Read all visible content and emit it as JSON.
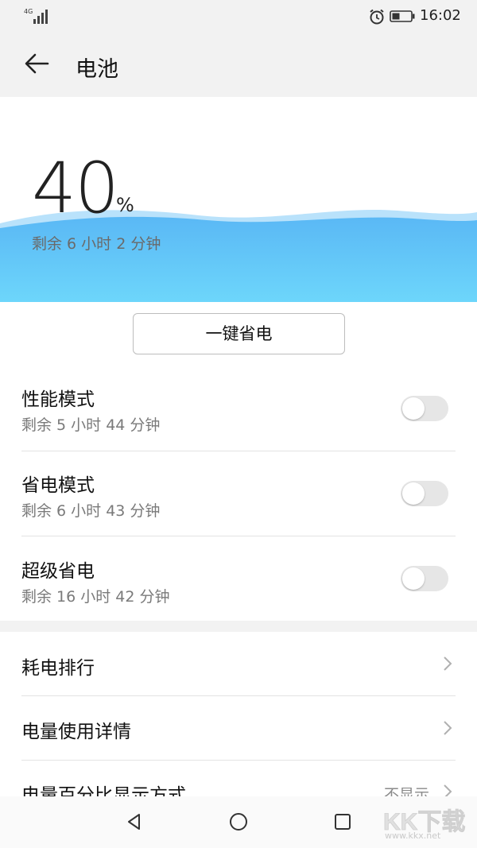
{
  "status_bar": {
    "network": "4G",
    "time": "16:02"
  },
  "header": {
    "title": "电池"
  },
  "battery": {
    "percent": "40",
    "percent_sign": "%",
    "remaining": "剩余 6 小时 2 分钟",
    "level": 0.4,
    "wave_colors": [
      "#5ab8f5",
      "#6dd6fb"
    ]
  },
  "save_button": {
    "label": "一键省电"
  },
  "modes": [
    {
      "title": "性能模式",
      "subtitle": "剩余 5 小时 44 分钟",
      "enabled": false
    },
    {
      "title": "省电模式",
      "subtitle": "剩余 6 小时 43 分钟",
      "enabled": false
    },
    {
      "title": "超级省电",
      "subtitle": "剩余 16 小时 42 分钟",
      "enabled": false
    }
  ],
  "links": [
    {
      "title": "耗电排行"
    },
    {
      "title": "电量使用详情"
    },
    {
      "title": "电量百分比显示方式",
      "value": "不显示"
    }
  ],
  "watermark": {
    "logo_text": "KK下载",
    "url": "www.kkx.net"
  }
}
